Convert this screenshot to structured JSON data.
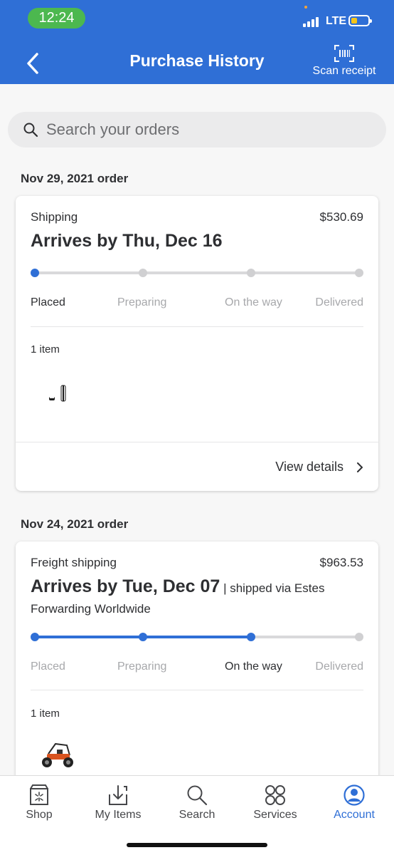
{
  "status_bar": {
    "time": "12:24",
    "network": "LTE"
  },
  "header": {
    "title": "Purchase History",
    "scan_label": "Scan receipt"
  },
  "search": {
    "placeholder": "Search your orders"
  },
  "orders": [
    {
      "date_label": "Nov 29, 2021 order",
      "shipping_type": "Shipping",
      "price": "$530.69",
      "arrives": "Arrives by Thu, Dec 16",
      "arrives_suffix": "",
      "arrives_line2": "",
      "progress_fraction": 0,
      "steps": [
        "Placed",
        "Preparing",
        "On the way",
        "Delivered"
      ],
      "current_step": 0,
      "items_count": "1 item",
      "view_details": "View details"
    },
    {
      "date_label": "Nov 24, 2021 order",
      "shipping_type": "Freight shipping",
      "price": "$963.53",
      "arrives": "Arrives by Tue, Dec 07",
      "arrives_suffix": " | shipped via Estes",
      "arrives_line2": "Forwarding Worldwide",
      "progress_fraction": 0.6667,
      "steps": [
        "Placed",
        "Preparing",
        "On the way",
        "Delivered"
      ],
      "current_step": 2,
      "items_count": "1 item"
    }
  ],
  "tabs": [
    {
      "label": "Shop",
      "icon": "shop-icon"
    },
    {
      "label": "My Items",
      "icon": "my-items-icon"
    },
    {
      "label": "Search",
      "icon": "search-icon"
    },
    {
      "label": "Services",
      "icon": "services-icon"
    },
    {
      "label": "Account",
      "icon": "account-icon",
      "active": true
    }
  ],
  "colors": {
    "brand_blue": "#2f6fd6",
    "status_green": "#4cb84f",
    "battery_yellow": "#f5c518"
  }
}
